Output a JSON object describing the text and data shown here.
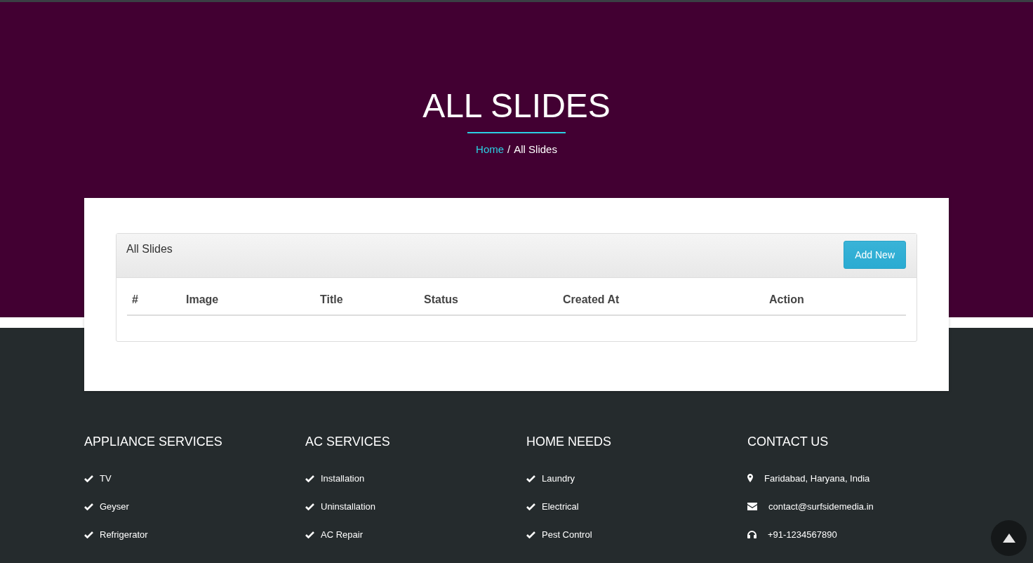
{
  "header": {
    "title": "ALL SLIDES",
    "breadcrumb": [
      {
        "label": "Home",
        "kind": "link"
      },
      {
        "label": "/",
        "kind": "separator"
      },
      {
        "label": "All Slides",
        "kind": "current"
      }
    ]
  },
  "panel": {
    "title": "All Slides",
    "button": "Add New",
    "columns": [
      "#",
      "Image",
      "Title",
      "Status",
      "Created At",
      "Action"
    ]
  },
  "footer": {
    "columns": [
      {
        "heading": "APPLIANCE SERVICES",
        "items": [
          {
            "label": "TV",
            "kind": "check"
          },
          {
            "label": "Geyser",
            "kind": "check"
          },
          {
            "label": "Refrigerator",
            "kind": "check"
          }
        ]
      },
      {
        "heading": "AC SERVICES",
        "items": [
          {
            "label": "Installation",
            "kind": "check"
          },
          {
            "label": "Uninstallation",
            "kind": "check"
          },
          {
            "label": "AC Repair",
            "kind": "check"
          }
        ]
      },
      {
        "heading": "HOME NEEDS",
        "items": [
          {
            "label": "Laundry",
            "kind": "check"
          },
          {
            "label": "Electrical",
            "kind": "check"
          },
          {
            "label": "Pest Control",
            "kind": "check"
          }
        ]
      },
      {
        "heading": "CONTACT US",
        "items": [
          {
            "label": "Faridabad, Haryana, India",
            "kind": "marker"
          },
          {
            "label": "contact@surfsidemedia.in",
            "kind": "envelope"
          },
          {
            "label": "+91-1234567890",
            "kind": "headphones"
          }
        ]
      }
    ]
  }
}
